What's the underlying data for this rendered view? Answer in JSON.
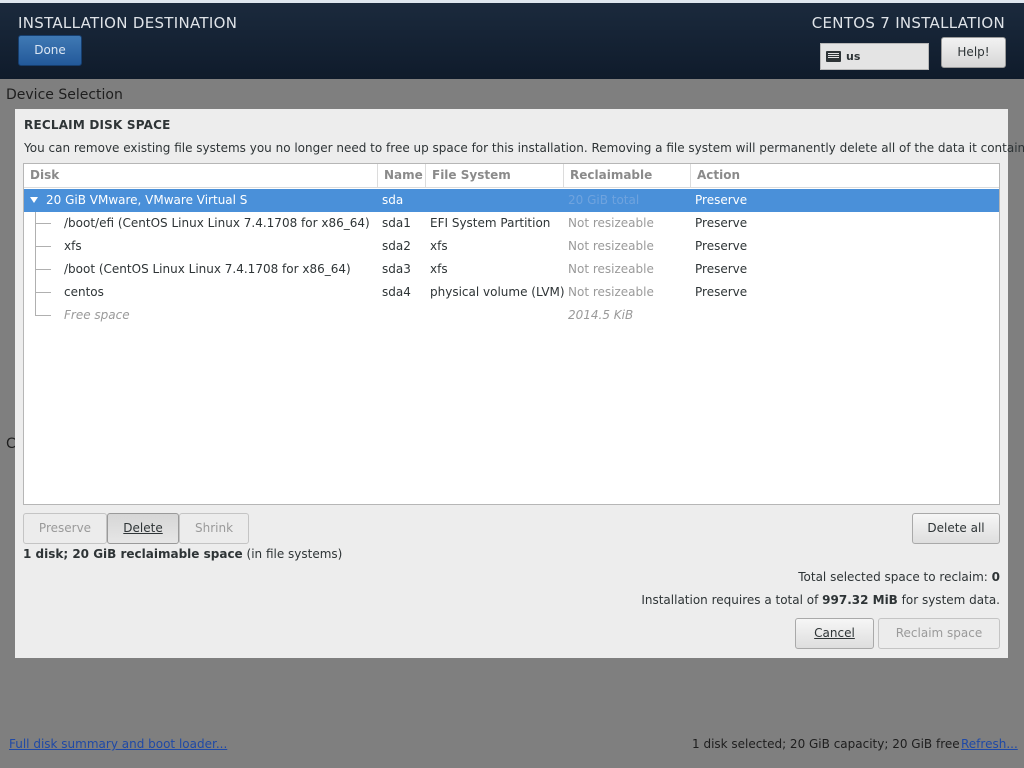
{
  "header": {
    "title": "INSTALLATION DESTINATION",
    "product": "CENTOS 7 INSTALLATION",
    "done_label": "Done",
    "keyboard_layout": "us",
    "help_label": "Help!"
  },
  "background": {
    "section_heading": "Device Selection",
    "partial_letter": "C",
    "full_disk_summary_link": "Full disk summary and boot loader...",
    "status": "1 disk selected; 20 GiB capacity; 20 GiB free",
    "refresh_link": "Refresh..."
  },
  "dialog": {
    "title": "RECLAIM DISK SPACE",
    "description": "You can remove existing file systems you no longer need to free up space for this installation.  Removing a file system will permanently delete all of the data it contains.",
    "columns": [
      "Disk",
      "Name",
      "File System",
      "Reclaimable Space",
      "Action"
    ],
    "rows": [
      {
        "disk": "20 GiB VMware, VMware Virtual S",
        "name": "sda",
        "fs": "",
        "reclaimable": "20 GiB total",
        "action": "Preserve"
      },
      {
        "disk": "/boot/efi (CentOS Linux Linux 7.4.1708 for x86_64)",
        "name": "sda1",
        "fs": "EFI System Partition",
        "reclaimable": "Not resizeable",
        "action": "Preserve"
      },
      {
        "disk": "xfs",
        "name": "sda2",
        "fs": "xfs",
        "reclaimable": "Not resizeable",
        "action": "Preserve"
      },
      {
        "disk": "/boot (CentOS Linux Linux 7.4.1708 for x86_64)",
        "name": "sda3",
        "fs": "xfs",
        "reclaimable": "Not resizeable",
        "action": "Preserve"
      },
      {
        "disk": "centos",
        "name": "sda4",
        "fs": "physical volume (LVM)",
        "reclaimable": "Not resizeable",
        "action": "Preserve"
      },
      {
        "disk": "Free space",
        "name": "",
        "fs": "",
        "reclaimable": "2014.5 KiB",
        "action": ""
      }
    ],
    "buttons": {
      "preserve": "Preserve",
      "delete": "Delete",
      "shrink": "Shrink",
      "delete_all": "Delete all",
      "cancel": "Cancel",
      "reclaim": "Reclaim space"
    },
    "summary_bold": "1 disk; 20 GiB reclaimable space",
    "summary_rest": " (in file systems)",
    "total_label": "Total selected space to reclaim: ",
    "total_value": "0",
    "req_prefix": "Installation requires a total of ",
    "req_value": "997.32 MiB",
    "req_suffix": " for system data."
  },
  "colors": {
    "selection": "#4a90d9",
    "header_bg": "#0f1b2b",
    "done_button": "#23599a",
    "link": "#1f49a6"
  }
}
